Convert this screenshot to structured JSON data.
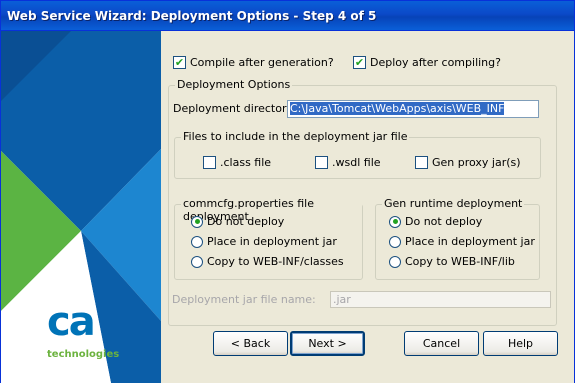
{
  "window": {
    "title": "Web Service Wizard: Deployment Options - Step 4 of 5"
  },
  "brand": {
    "logo_text": "ca",
    "tagline": "technologies"
  },
  "options": {
    "compile_label": "Compile after generation?",
    "compile_checked": true,
    "deploy_label": "Deploy after compiling?",
    "deploy_checked": true
  },
  "deployment": {
    "group_label": "Deployment Options",
    "dir_label": "Deployment directory:",
    "dir_value": "C:\\Java\\Tomcat\\WebApps\\axis\\WEB_INF",
    "files_group_label": "Files to include in the deployment jar file",
    "files": [
      {
        "label": ".class file",
        "checked": false
      },
      {
        "label": ".wsdl file",
        "checked": false
      },
      {
        "label": "Gen proxy jar(s)",
        "checked": false
      }
    ],
    "commcfg": {
      "label": "commcfg.properties file deployment",
      "options": [
        "Do not deploy",
        "Place in deployment jar",
        "Copy to WEB-INF/classes"
      ],
      "selected": 0
    },
    "runtime": {
      "label": "Gen runtime deployment",
      "options": [
        "Do not deploy",
        "Place in deployment jar",
        "Copy to WEB-INF/lib"
      ],
      "selected": 0
    },
    "jar_name_label": "Deployment jar file name:",
    "jar_name_placeholder": ".jar"
  },
  "buttons": {
    "back": "< Back",
    "next": "Next >",
    "cancel": "Cancel",
    "help": "Help"
  },
  "colors": {
    "blue_dark": "#0b5ea8",
    "blue_light": "#1d86d0",
    "green": "#5bb443",
    "ca_blue": "#0073b7",
    "ca_green": "#6cb33f"
  }
}
